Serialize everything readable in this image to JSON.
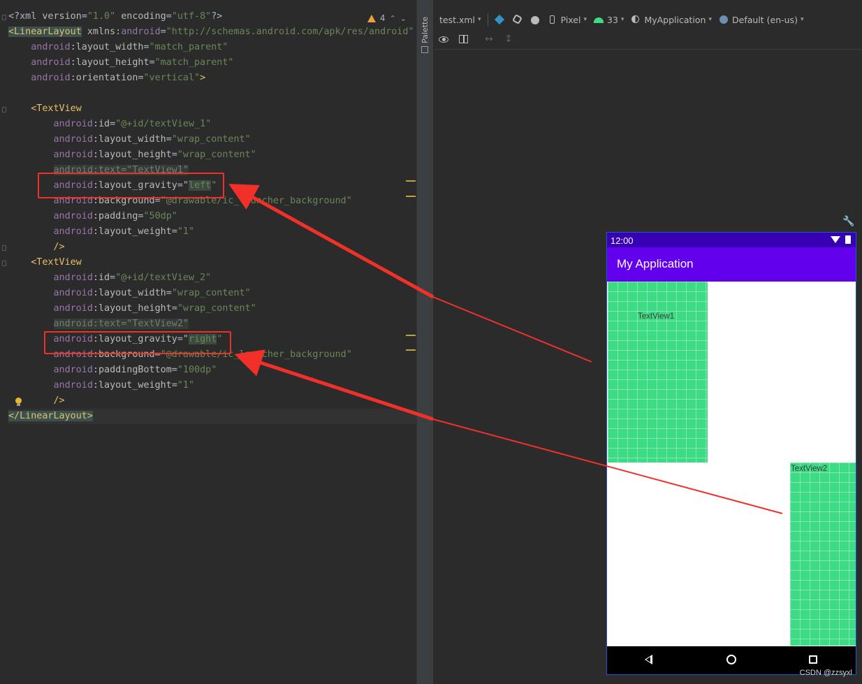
{
  "editor": {
    "inspections": {
      "warning_count": "4",
      "up_glyph": "⌃",
      "down_glyph": "⌄"
    },
    "lines": [
      [
        {
          "t": "<?xml ",
          "c": "t-muted"
        },
        {
          "t": "version",
          "c": "t-attr"
        },
        {
          "t": "=",
          "c": "t-muted"
        },
        {
          "t": "\"1.0\"",
          "c": "t-val"
        },
        {
          "t": " ",
          "c": ""
        },
        {
          "t": "encoding",
          "c": "t-attr"
        },
        {
          "t": "=",
          "c": "t-muted"
        },
        {
          "t": "\"utf-8\"",
          "c": "t-val"
        },
        {
          "t": "?>",
          "c": "t-muted"
        }
      ],
      [
        {
          "t": "<LinearLayout",
          "c": "t-tag t-hl"
        },
        {
          "t": " ",
          "c": ""
        },
        {
          "t": "xmlns:",
          "c": "t-attr"
        },
        {
          "t": "android",
          "c": "t-ns"
        },
        {
          "t": "=",
          "c": "t-muted"
        },
        {
          "t": "\"http://schemas.android.com/apk/res/android\"",
          "c": "t-val"
        }
      ],
      [
        {
          "t": "    ",
          "c": ""
        },
        {
          "t": "android",
          "c": "t-ns"
        },
        {
          "t": ":layout_width",
          "c": "t-attr"
        },
        {
          "t": "=",
          "c": "t-muted"
        },
        {
          "t": "\"match_parent\"",
          "c": "t-val"
        }
      ],
      [
        {
          "t": "    ",
          "c": ""
        },
        {
          "t": "android",
          "c": "t-ns"
        },
        {
          "t": ":layout_height",
          "c": "t-attr"
        },
        {
          "t": "=",
          "c": "t-muted"
        },
        {
          "t": "\"match_parent\"",
          "c": "t-val"
        }
      ],
      [
        {
          "t": "    ",
          "c": ""
        },
        {
          "t": "android",
          "c": "t-ns"
        },
        {
          "t": ":orientation",
          "c": "t-attr"
        },
        {
          "t": "=",
          "c": "t-muted"
        },
        {
          "t": "\"vertical\"",
          "c": "t-val"
        },
        {
          "t": ">",
          "c": "t-tag"
        }
      ],
      [],
      [
        {
          "t": "    ",
          "c": ""
        },
        {
          "t": "<TextView",
          "c": "t-tag"
        }
      ],
      [
        {
          "t": "        ",
          "c": ""
        },
        {
          "t": "android",
          "c": "t-ns"
        },
        {
          "t": ":id",
          "c": "t-attr"
        },
        {
          "t": "=",
          "c": "t-muted"
        },
        {
          "t": "\"@+id/textView_1\"",
          "c": "t-val"
        }
      ],
      [
        {
          "t": "        ",
          "c": ""
        },
        {
          "t": "android",
          "c": "t-ns"
        },
        {
          "t": ":layout_width",
          "c": "t-attr"
        },
        {
          "t": "=",
          "c": "t-muted"
        },
        {
          "t": "\"wrap_content\"",
          "c": "t-val"
        }
      ],
      [
        {
          "t": "        ",
          "c": ""
        },
        {
          "t": "android",
          "c": "t-ns"
        },
        {
          "t": ":layout_height",
          "c": "t-attr"
        },
        {
          "t": "=",
          "c": "t-muted"
        },
        {
          "t": "\"wrap_content\"",
          "c": "t-val"
        }
      ],
      [
        {
          "t": "        ",
          "c": ""
        },
        {
          "t": "android:text=\"TextView1\"",
          "c": "t-hlv t-dim t-attr"
        }
      ],
      [
        {
          "t": "        ",
          "c": ""
        },
        {
          "t": "android",
          "c": "t-ns"
        },
        {
          "t": ":layout_gravity",
          "c": "t-attr"
        },
        {
          "t": "=\"",
          "c": "t-muted"
        },
        {
          "t": "left",
          "c": "t-val t-hlv"
        },
        {
          "t": "\"",
          "c": "t-val"
        }
      ],
      [
        {
          "t": "        ",
          "c": ""
        },
        {
          "t": "android",
          "c": "t-ns"
        },
        {
          "t": ":background",
          "c": "t-attr"
        },
        {
          "t": "=",
          "c": "t-muted"
        },
        {
          "t": "\"@drawable/ic_launcher_background\"",
          "c": "t-val"
        }
      ],
      [
        {
          "t": "        ",
          "c": ""
        },
        {
          "t": "android",
          "c": "t-ns"
        },
        {
          "t": ":padding",
          "c": "t-attr"
        },
        {
          "t": "=",
          "c": "t-muted"
        },
        {
          "t": "\"50dp\"",
          "c": "t-val"
        }
      ],
      [
        {
          "t": "        ",
          "c": ""
        },
        {
          "t": "android",
          "c": "t-ns"
        },
        {
          "t": ":layout_weight",
          "c": "t-attr"
        },
        {
          "t": "=",
          "c": "t-muted"
        },
        {
          "t": "\"1\"",
          "c": "t-val"
        }
      ],
      [
        {
          "t": "        ",
          "c": ""
        },
        {
          "t": "/>",
          "c": "t-tag"
        }
      ],
      [
        {
          "t": "    ",
          "c": ""
        },
        {
          "t": "<TextView",
          "c": "t-tag"
        }
      ],
      [
        {
          "t": "        ",
          "c": ""
        },
        {
          "t": "android",
          "c": "t-ns"
        },
        {
          "t": ":id",
          "c": "t-attr"
        },
        {
          "t": "=",
          "c": "t-muted"
        },
        {
          "t": "\"@+id/textView_2\"",
          "c": "t-val"
        }
      ],
      [
        {
          "t": "        ",
          "c": ""
        },
        {
          "t": "android",
          "c": "t-ns"
        },
        {
          "t": ":layout_width",
          "c": "t-attr"
        },
        {
          "t": "=",
          "c": "t-muted"
        },
        {
          "t": "\"wrap_content\"",
          "c": "t-val"
        }
      ],
      [
        {
          "t": "        ",
          "c": ""
        },
        {
          "t": "android",
          "c": "t-ns"
        },
        {
          "t": ":layout_height",
          "c": "t-attr"
        },
        {
          "t": "=",
          "c": "t-muted"
        },
        {
          "t": "\"wrap_content\"",
          "c": "t-val"
        }
      ],
      [
        {
          "t": "        ",
          "c": ""
        },
        {
          "t": "android:text=\"TextView2\"",
          "c": "t-hlv t-dim t-attr"
        }
      ],
      [
        {
          "t": "        ",
          "c": ""
        },
        {
          "t": "android",
          "c": "t-ns"
        },
        {
          "t": ":layout_gravity",
          "c": "t-attr"
        },
        {
          "t": "=\"",
          "c": "t-muted"
        },
        {
          "t": "right",
          "c": "t-val t-hlv"
        },
        {
          "t": "\"",
          "c": "t-val"
        }
      ],
      [
        {
          "t": "        ",
          "c": ""
        },
        {
          "t": "android",
          "c": "t-ns"
        },
        {
          "t": ":background",
          "c": "t-attr"
        },
        {
          "t": "=",
          "c": "t-muted"
        },
        {
          "t": "\"@drawable/ic_launcher_background\"",
          "c": "t-val"
        }
      ],
      [
        {
          "t": "        ",
          "c": ""
        },
        {
          "t": "android",
          "c": "t-ns"
        },
        {
          "t": ":paddingBottom",
          "c": "t-attr"
        },
        {
          "t": "=",
          "c": "t-muted"
        },
        {
          "t": "\"100dp\"",
          "c": "t-val"
        }
      ],
      [
        {
          "t": "        ",
          "c": ""
        },
        {
          "t": "android",
          "c": "t-ns"
        },
        {
          "t": ":layout_weight",
          "c": "t-attr"
        },
        {
          "t": "=",
          "c": "t-muted"
        },
        {
          "t": "\"1\"",
          "c": "t-val"
        }
      ],
      [
        {
          "t": "        ",
          "c": ""
        },
        {
          "t": "/>",
          "c": "t-tag"
        }
      ],
      [
        {
          "t": "</LinearLayout>",
          "c": "t-tag t-hl"
        }
      ]
    ]
  },
  "palette": {
    "label": "Palette"
  },
  "design_toolbar": {
    "file": "test.xml",
    "device": "Pixel",
    "api_level": "33",
    "theme": "MyApplication",
    "locale": "Default (en-us)"
  },
  "device_preview": {
    "status_time": "12:00",
    "app_title": "My Application",
    "textview1": "TextView1",
    "textview2": "TextView2"
  },
  "watermark": "CSDN @zzsyxl",
  "colors": {
    "annotation_red": "#f2302a",
    "status_bar": "#3700b3",
    "app_bar": "#6200ee",
    "textview_bg": "#3ddc84"
  }
}
